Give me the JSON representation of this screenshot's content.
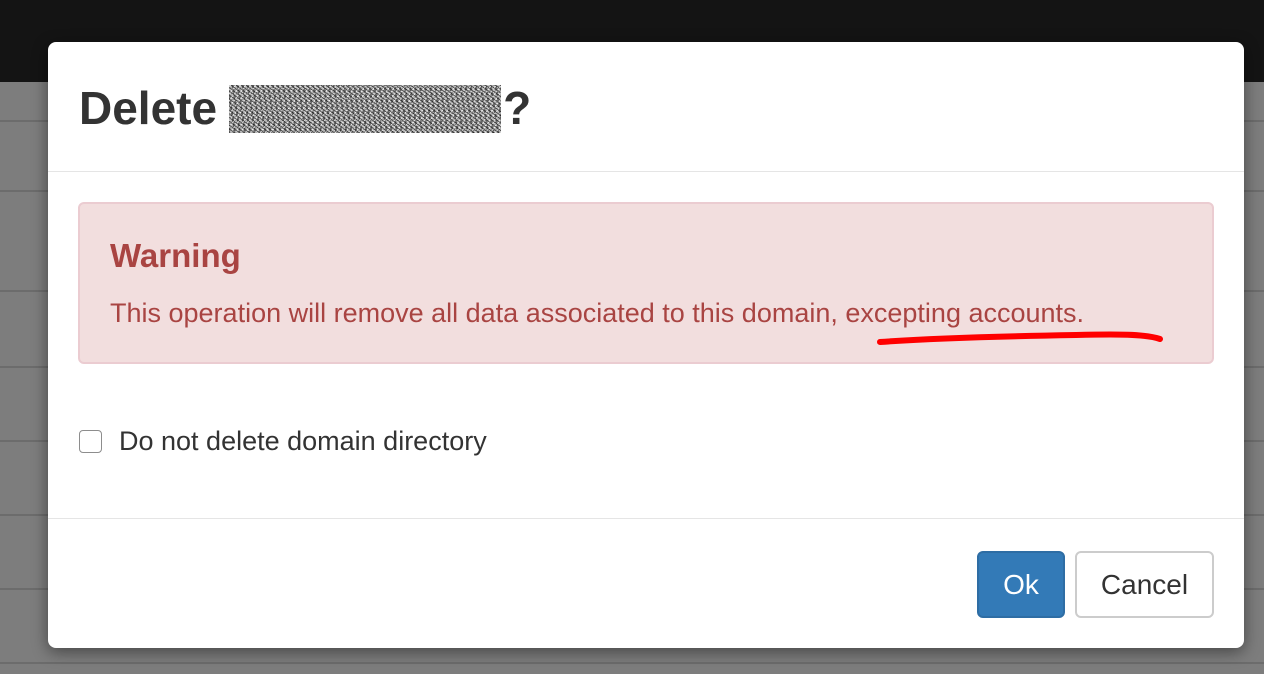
{
  "dialog": {
    "title_prefix": "Delete",
    "title_suffix": "?",
    "title_target_redacted": true
  },
  "alert": {
    "heading": "Warning",
    "message_main": "This operation will remove all data associated to this domain, ",
    "message_highlight": "excepting accounts.",
    "highlight_mark_color": "#ff0000"
  },
  "option": {
    "checkbox_label": "Do not delete domain directory",
    "checked": false
  },
  "footer": {
    "ok_label": "Ok",
    "cancel_label": "Cancel"
  },
  "colors": {
    "primary": "#337ab7",
    "danger_text": "#a94442",
    "danger_bg": "#f2dede"
  }
}
